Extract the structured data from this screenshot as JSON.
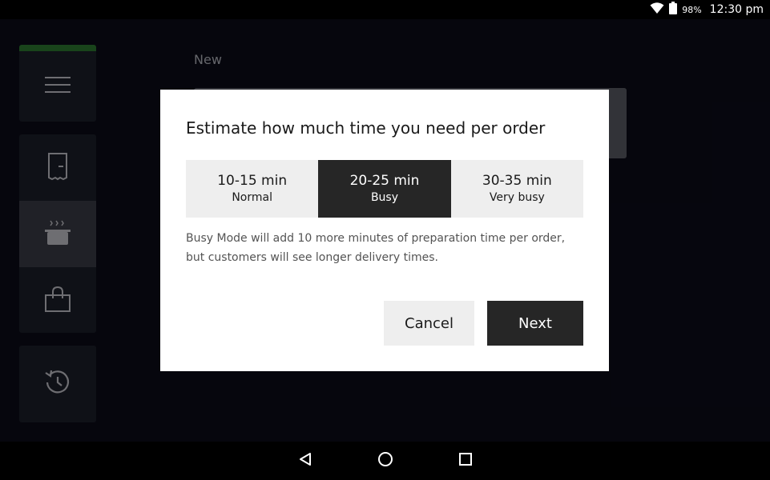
{
  "status_bar": {
    "battery_percent": "98%",
    "time": "12:30 pm"
  },
  "sidebar": {
    "items": [
      {
        "name": "menu",
        "icon": "hamburger-menu-icon"
      },
      {
        "name": "orders",
        "icon": "receipt-icon"
      },
      {
        "name": "kitchen",
        "icon": "cooking-pot-icon",
        "active": true
      },
      {
        "name": "bag",
        "icon": "shopping-bag-icon"
      },
      {
        "name": "history",
        "icon": "history-icon"
      }
    ],
    "accent_color": "#2f7d32"
  },
  "main": {
    "tab_new": "New"
  },
  "modal": {
    "title": "Estimate how much time you need per order",
    "options": [
      {
        "time": "10-15 min",
        "label": "Normal",
        "selected": false
      },
      {
        "time": "20-25 min",
        "label": "Busy",
        "selected": true
      },
      {
        "time": "30-35 min",
        "label": "Very busy",
        "selected": false
      }
    ],
    "description": "Busy Mode will add 10 more minutes of preparation time per order, but customers will see longer delivery times.",
    "cancel_label": "Cancel",
    "next_label": "Next"
  },
  "nav_bar": {
    "buttons": [
      "back-icon",
      "home-icon",
      "recents-icon"
    ]
  }
}
